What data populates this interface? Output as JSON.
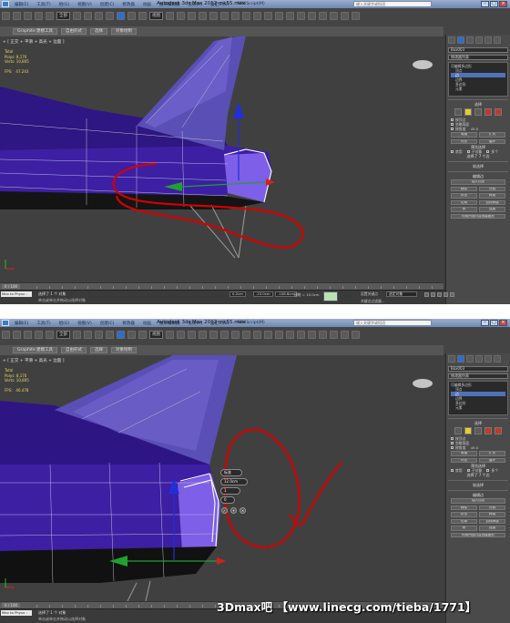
{
  "app": {
    "title": "Autodesk 3ds Max 2012    mk55.max",
    "menus": [
      "编辑(E)",
      "工具(T)",
      "组(G)",
      "视图(V)",
      "创建(C)",
      "修改器",
      "动画",
      "图形编辑器",
      "渲染(R)",
      "自定义(U)",
      "MAXScript(M)",
      "帮助(H)"
    ],
    "search_placeholder": "键入关键字或短语",
    "select_filter": "全部",
    "view_dropdown": "视图"
  },
  "ribbon": {
    "tabs": [
      "Graphite 建模工具",
      "自由形式",
      "选择",
      "对象绘制"
    ]
  },
  "viewport": {
    "label": "+ [ 正交 + 平滑 + 高光 + 边面 ]",
    "stats_top": "Total\nPolys: 8,170\nVerts: 10,805\n\nFPS:   47.243",
    "stats_bottom": "Total\nPolys: 8,170\nVerts: 10,805\n\nFPS:   46.478"
  },
  "command_panel": {
    "object_name": "Box003",
    "modifier_list": "修改器列表",
    "stack": [
      {
        "label": "可编辑多边形",
        "active": false,
        "indent": false
      },
      {
        "label": "顶点",
        "active": false,
        "indent": true
      },
      {
        "label": "边",
        "active": true,
        "indent": true
      },
      {
        "label": "边界",
        "active": false,
        "indent": true
      },
      {
        "label": "多边形",
        "active": false,
        "indent": true
      },
      {
        "label": "元素",
        "active": false,
        "indent": true
      }
    ],
    "selection_title": "选择",
    "checkboxes": [
      "按顶点",
      "忽略背面",
      "按角度"
    ],
    "angle_value": "45.0",
    "shrink": "收缩",
    "grow": "扩大",
    "ring": "环形",
    "loop": "循环",
    "preview_label": "预览选择",
    "preview_off": "禁用",
    "preview_sub": "子对象",
    "preview_multi": "多个",
    "selected_top": "选择了 7 个边",
    "selected_bottom": "选择了 7 个边",
    "soft_sel": "软选择",
    "edit_edges": "编辑边",
    "insert_vertex": "插入顶点",
    "remove": "移除",
    "split": "分割",
    "extrude": "挤出",
    "weld": "焊接",
    "chamfer": "切角",
    "target_weld": "目标焊接",
    "bridge": "桥",
    "connect": "连接",
    "create_shape": "利用所选内容创建图形"
  },
  "timeslider": {
    "frame": "0 / 100"
  },
  "status": {
    "max_to_physx": "Max to Physx :",
    "msg_selected": "选择了 1 个 对象",
    "msg_hint": "单击或单击并拖动以选择对象",
    "x": "0.2cm",
    "y": "-23.0cm",
    "z": "-108.6cm",
    "grid": "栅格 = 10.0cm",
    "set_key": "设置关键点",
    "selection_set": "选定对象",
    "key_filters": "关键点过滤器..."
  },
  "chamfer_caddy": {
    "mode": "标准",
    "amount": "12.0cm",
    "segments": "1",
    "extra": "0"
  },
  "watermark": "3Dmax吧 【www.linecg.com/tieba/1771】",
  "colors": {
    "accent": "#2a6fd0",
    "annotation": "#d40000",
    "mesh": "#3d1fa0",
    "selection": "#4e73b8"
  }
}
